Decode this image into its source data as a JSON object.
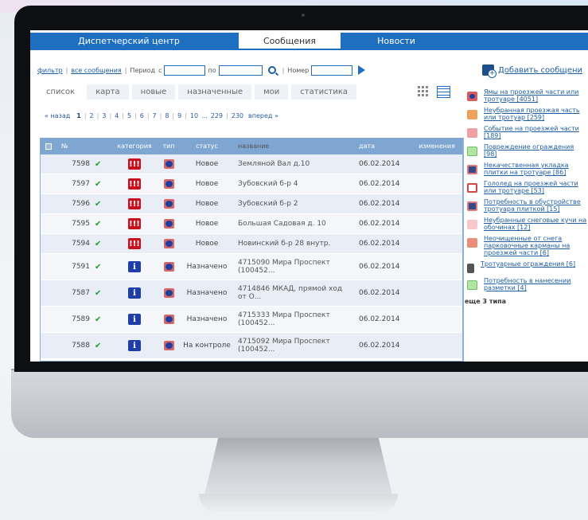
{
  "topnav": {
    "dispatch": "Диспетчерский центр",
    "messages": "Сообщения",
    "news": "Новости"
  },
  "filter": {
    "filter_link": "фильтр",
    "all_link": "все сообщения",
    "period": "Период",
    "from": "с",
    "to": "по",
    "number": "Номер"
  },
  "add_button": "Добавить сообщени",
  "tabs": [
    "список",
    "карта",
    "новые",
    "назначенные",
    "мои",
    "статистика"
  ],
  "pager": {
    "back": "« назад",
    "pages": [
      "1",
      "2",
      "3",
      "4",
      "5",
      "6",
      "7",
      "8",
      "9",
      "10",
      "...",
      "229",
      "230"
    ],
    "forward": "вперед »"
  },
  "table": {
    "headers": {
      "num": "№",
      "category": "категория",
      "type": "тип",
      "status": "статус",
      "name": "название",
      "date": "дата",
      "changes": "изменения"
    },
    "rows": [
      {
        "num": "7598",
        "mark": "✔",
        "cat": "!!!",
        "status": "Новое",
        "name": "Земляной Вал д.10",
        "date": "06.02.2014"
      },
      {
        "num": "7597",
        "mark": "✔",
        "cat": "!!!",
        "status": "Новое",
        "name": "Зубовский б-р 4",
        "date": "06.02.2014"
      },
      {
        "num": "7596",
        "mark": "✔",
        "cat": "!!!",
        "status": "Новое",
        "name": "Зубовский б-р 2",
        "date": "06.02.2014"
      },
      {
        "num": "7595",
        "mark": "✔",
        "cat": "!!!",
        "status": "Новое",
        "name": "Большая Садовая д. 10",
        "date": "06.02.2014"
      },
      {
        "num": "7594",
        "mark": "✔",
        "cat": "!!!",
        "status": "Новое",
        "name": "Новинский б-р 28 внутр.",
        "date": "06.02.2014"
      },
      {
        "num": "7591",
        "mark": "✔",
        "cat": "i",
        "status": "Назначено",
        "name": "4715090 Мира Проспект (100452...",
        "date": "06.02.2014"
      },
      {
        "num": "7587",
        "mark": "✔",
        "cat": "i",
        "status": "Назначено",
        "name": "4714846 МКАД, прямой ход от О...",
        "date": "06.02.2014"
      },
      {
        "num": "7589",
        "mark": "✔",
        "cat": "i",
        "status": "Назначено",
        "name": "4715333 Мира Проспект (100452...",
        "date": "06.02.2014"
      },
      {
        "num": "7588",
        "mark": "✔",
        "cat": "i",
        "status": "На контроле",
        "name": "4715092 Мира Проспект (100452...",
        "date": "06.02.2014"
      }
    ]
  },
  "sidebar": {
    "items": [
      "Ямы на проезжей части или тротуаре [4051]",
      "Неубранная проезжая часть или тротуар [259]",
      "Событие на проезжей части [189]",
      "Повреждение ограждения [98]",
      "Некачественная укладка плитки на тротуаре [86]",
      "Гололед на проезжей части или тротуаре [53]",
      "Потребность в обустройстве тротуара плиткой [15]",
      "Неубранные снеговые кучи на обочинах [12]",
      "Неочищенные от снега парковочные карманы на проезжей части [6]",
      "Тротуарные ограждения [6]",
      "Потребность в нанесении разметки [4]"
    ],
    "more": "еще 3 типа"
  }
}
